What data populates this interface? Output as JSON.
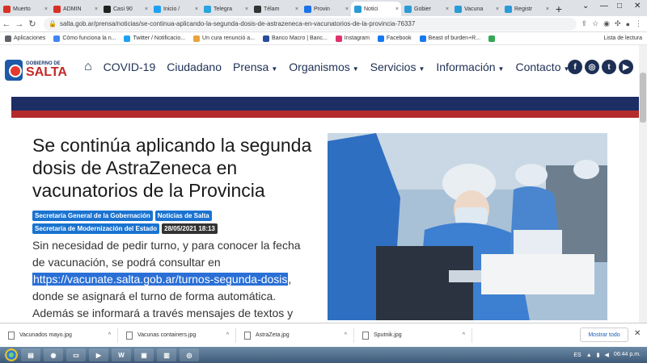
{
  "browser": {
    "tabs": [
      {
        "label": "Muerto",
        "color": "#d93025"
      },
      {
        "label": "ADMIN",
        "color": "#d93025"
      },
      {
        "label": "Casi 90",
        "color": "#222222"
      },
      {
        "label": "Inicio /",
        "color": "#1da1f2"
      },
      {
        "label": "Telegra",
        "color": "#2aa3df"
      },
      {
        "label": "Télam",
        "color": "#333333"
      },
      {
        "label": "Provin",
        "color": "#1a73e8"
      },
      {
        "label": "Notici",
        "color": "#2a9bd6"
      },
      {
        "label": "Gobier",
        "color": "#2a9bd6"
      },
      {
        "label": "Vacuna",
        "color": "#2a9bd6"
      },
      {
        "label": "Registr",
        "color": "#2a9bd6"
      }
    ],
    "active_tab_index": 7,
    "url": "salta.gob.ar/prensa/noticias/se-continua-aplicando-la-segunda-dosis-de-astrazeneca-en-vacunatorios-de-la-provincia-76337",
    "bookmarks": [
      {
        "label": "Aplicaciones",
        "color": "#5f6368"
      },
      {
        "label": "Cómo funciona la n...",
        "color": "#4285f4"
      },
      {
        "label": "Twitter / Notificacio...",
        "color": "#1da1f2"
      },
      {
        "label": "Un cura renunció a...",
        "color": "#e8a33a"
      },
      {
        "label": "Banco Macro | Banc...",
        "color": "#2b4c9a"
      },
      {
        "label": "Instagram",
        "color": "#e1306c"
      },
      {
        "label": "Facebook",
        "color": "#1877f2"
      },
      {
        "label": "Beast of burden+R...",
        "color": "#1877f2"
      },
      {
        "label": "",
        "color": "#34a853"
      }
    ],
    "reading_list": "Lista de lectura"
  },
  "site": {
    "logo_small": "GOBIERNO DE",
    "logo_big": "SALTA",
    "menu": [
      "COVID-19",
      "Ciudadano",
      "Prensa",
      "Organismos",
      "Servicios",
      "Información",
      "Contacto"
    ],
    "menu_has_caret": [
      false,
      false,
      true,
      true,
      true,
      true,
      true
    ],
    "socials": [
      "f",
      "◎",
      "t",
      "▶"
    ]
  },
  "article": {
    "title": "Se continúa aplicando la segunda dosis de AstraZeneca en vacunatorios de la Provincia",
    "tags": [
      "Secretaría General de la Gobernación",
      "Noticias de Salta",
      "Secretaría de Modernización del Estado"
    ],
    "date": "28/05/2021 18:13",
    "body_before": "Sin necesidad de pedir turno, y para conocer la fecha de vacunación, se podrá consultar en",
    "link": "https://vacunate.salta.gob.ar/turnos-segunda-dosis",
    "body_after": ", donde se asignará el turno de forma automática. Además se informará a través mensajes de textos y"
  },
  "downloads": {
    "files": [
      "Vacunados mayo.jpg",
      "Vacunas containers.jpg",
      "AstraZeta.jpg",
      "Sputnik.jpg"
    ],
    "show_all": "Mostrar todo"
  },
  "taskbar": {
    "lang": "ES",
    "time": "06:44 p.m.",
    "date": ""
  }
}
